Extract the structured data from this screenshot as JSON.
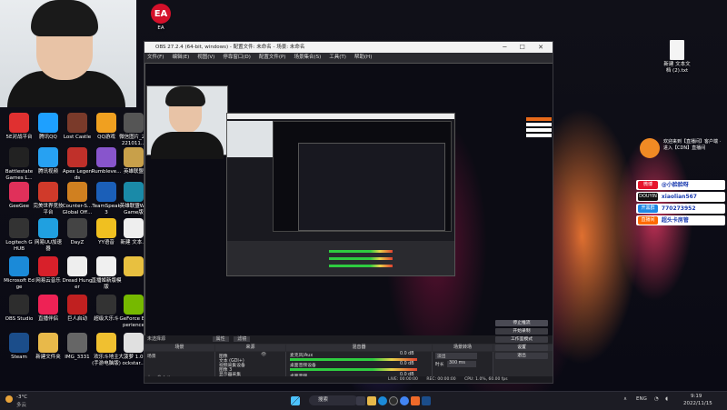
{
  "desktop": {
    "top_icons": [
      {
        "label": "EA",
        "color": "#d4102a",
        "glyph": "EA"
      }
    ],
    "right_icon": {
      "label": "新建 文本文档 (2).txt"
    },
    "left_icons": [
      {
        "label": "5E对战平台",
        "color": "#e03030"
      },
      {
        "label": "腾讯QQ",
        "color": "#1ea0ff"
      },
      {
        "label": "Lost Castle",
        "color": "#7a3a2a"
      },
      {
        "label": "QQ游戏",
        "color": "#f0a020"
      },
      {
        "label": "微信图片_20221011...",
        "color": "#555555"
      },
      {
        "label": "Battlestate Games L...",
        "color": "#222222"
      },
      {
        "label": "腾讯视频",
        "color": "#27a1f2"
      },
      {
        "label": "Apex Legends",
        "color": "#c0302a"
      },
      {
        "label": "Rumbleve...",
        "color": "#8855cc"
      },
      {
        "label": "英雄联盟",
        "color": "#c8a04a"
      },
      {
        "label": "GeeGee",
        "color": "#e0305a"
      },
      {
        "label": "完美世界竞技平台",
        "color": "#d03a2a"
      },
      {
        "label": "Counter-S... Global Off...",
        "color": "#d08020"
      },
      {
        "label": "TeamSpeak 3",
        "color": "#1b5fb8"
      },
      {
        "label": "英雄联盟WeGame版",
        "color": "#1a8aa8"
      },
      {
        "label": "Logitech G HUB",
        "color": "#333333"
      },
      {
        "label": "网易UU加速器",
        "color": "#20a0e0"
      },
      {
        "label": "DayZ",
        "color": "#444444"
      },
      {
        "label": "YY语音",
        "color": "#f0c020"
      },
      {
        "label": "新建 文本...",
        "color": "#eeeeee"
      },
      {
        "label": "Microsoft Edge",
        "color": "#1b8ad8"
      },
      {
        "label": "网易云音乐",
        "color": "#d8202a"
      },
      {
        "label": "Dread Hunger",
        "color": "#eeeeee"
      },
      {
        "label": "直播姬新版模版",
        "color": "#f0f0f0"
      },
      {
        "label": "",
        "color": "#e8c040"
      },
      {
        "label": "OBS Studio",
        "color": "#2d2d2d"
      },
      {
        "label": "直播伴侣",
        "color": "#ee2255"
      },
      {
        "label": "巨人启动",
        "color": "#c02020"
      },
      {
        "label": "超级大乐斗",
        "color": "#333333"
      },
      {
        "label": "GeForce Experience",
        "color": "#76b900"
      },
      {
        "label": "Steam",
        "color": "#1b4d8a"
      },
      {
        "label": "新建文件夹",
        "color": "#e8b94a"
      },
      {
        "label": "IMG_3331",
        "color": "#666666"
      },
      {
        "label": "欢乐斗地主(手游电脑版)",
        "color": "#f0c030"
      },
      {
        "label": "大菠萝 1.0(Rockstar...",
        "color": "#e0e0e0"
      }
    ]
  },
  "obs": {
    "title": "OBS 27.2.4 (64-bit, windows) - 配置文件: 未命名 - 场景: 未命名",
    "menu": [
      "文件(F)",
      "编辑(E)",
      "视图(V)",
      "停靠窗口(D)",
      "配置文件(P)",
      "场景集合(S)",
      "工具(T)",
      "帮助(H)"
    ],
    "source_bar": {
      "label": "未选择源",
      "properties": "属性",
      "filters": "滤镜"
    },
    "docks": {
      "scenes_title": "场景",
      "scenes": [
        "场景"
      ],
      "sources_title": "来源",
      "sources": [
        "图像",
        "文本 (GDI+)",
        "视频采集设备",
        "图像 3",
        "显示器采集"
      ],
      "mixer_title": "混音器",
      "mixer": [
        {
          "name": "麦克风/Aux",
          "db": "0.0 dB"
        },
        {
          "name": "桌面音频设备",
          "db": "0.0 dB"
        },
        {
          "name": "桌面音频",
          "db": "0.0 dB"
        }
      ],
      "transitions_title": "场景转场",
      "transition_value": "淡出",
      "duration_label": "时长",
      "duration_value": "300 ms",
      "controls_title": "控件",
      "controls": [
        "停止推流",
        "开始录制",
        "工作室模式",
        "设置",
        "退出"
      ]
    },
    "status": {
      "live": "LIVE: 00:00:00",
      "rec": "REC: 00:00:00",
      "cpu": "CPU: 1.0%, 60.00 fps"
    }
  },
  "overlay": {
    "banner": "欢迎来到【直播间】客户端 · 进入【CDN】直播间",
    "rows": [
      {
        "platform": "微博",
        "value": "@小脸脸呀",
        "color": "#e6162d"
      },
      {
        "platform": "DOUYIN",
        "value": "xiaolian567",
        "color": "#111111"
      },
      {
        "platform": "开黑群",
        "value": "770273952",
        "color": "#1e88e5"
      },
      {
        "platform": "直播间",
        "value": "超头卡房管",
        "color": "#ff6a00"
      }
    ]
  },
  "taskbar": {
    "weather": "-3°C",
    "weather_sub": "多云",
    "search": "搜索",
    "lang": "ENG",
    "time": "9:19",
    "date": "2022/11/15"
  }
}
